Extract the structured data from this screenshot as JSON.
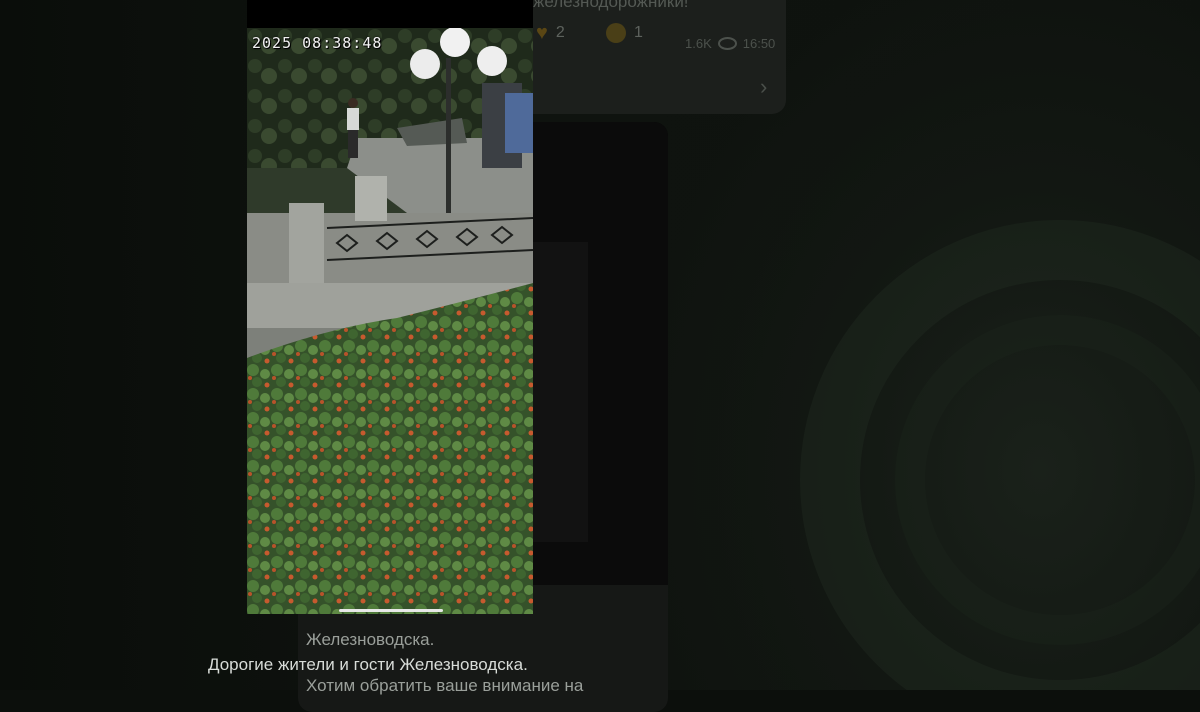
{
  "previous_message": {
    "text_fragment": "железнодорожники!",
    "reactions": [
      {
        "icon": "heart-icon",
        "count": "2"
      },
      {
        "icon": "grin-emoji-icon",
        "count": "1"
      }
    ],
    "views": "1.6K",
    "time": "16:50"
  },
  "post": {
    "text_line1": "Железноводска.",
    "text_line2": "Хотим обратить ваше внимание на"
  },
  "viewer": {
    "timestamp": "2025 08:38:48",
    "caption": "Дорогие жители и гости Железноводска."
  },
  "colors": {
    "overlay": "#0c0f0c",
    "video_foliage": "#3f5b2c",
    "caption_text": "#d8dcd8"
  }
}
